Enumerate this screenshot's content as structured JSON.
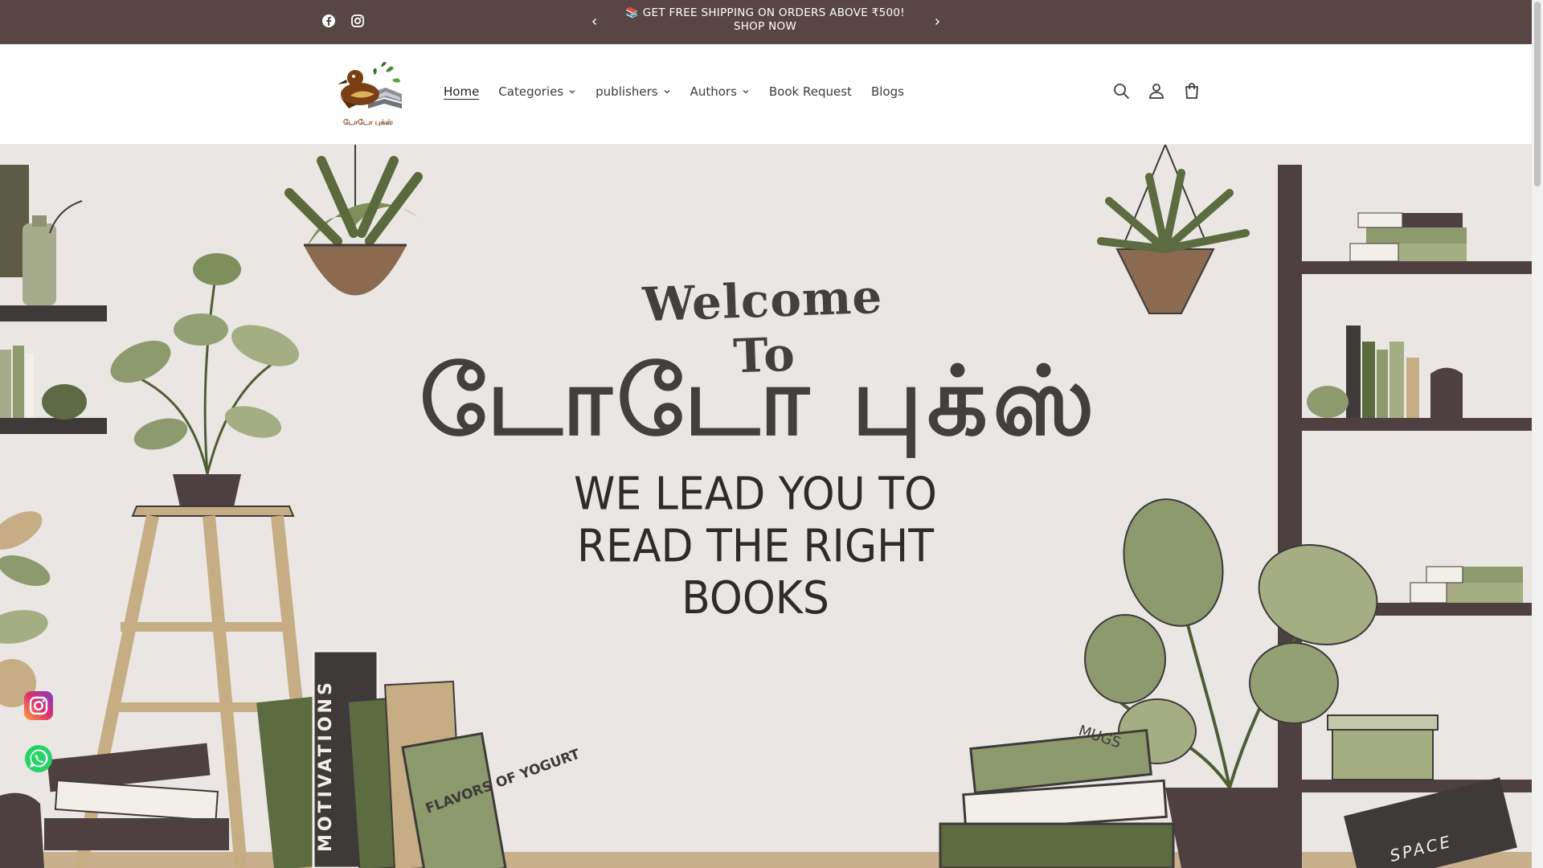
{
  "announcement": {
    "text": "📚 GET FREE SHIPPING ON ORDERS ABOVE ₹500! SHOP NOW",
    "prev_icon": "chevron-left-icon",
    "next_icon": "chevron-right-icon",
    "social": [
      "facebook-icon",
      "instagram-icon"
    ]
  },
  "header": {
    "logo_text": "டோடோ புக்ஸ்",
    "nav": [
      {
        "label": "Home",
        "active": true,
        "dropdown": false
      },
      {
        "label": "Categories",
        "active": false,
        "dropdown": true
      },
      {
        "label": "publishers",
        "active": false,
        "dropdown": true
      },
      {
        "label": "Authors",
        "active": false,
        "dropdown": true
      },
      {
        "label": "Book Request",
        "active": false,
        "dropdown": false
      },
      {
        "label": "Blogs",
        "active": false,
        "dropdown": false
      }
    ],
    "icons": [
      "search-icon",
      "account-icon",
      "cart-icon"
    ]
  },
  "hero": {
    "welcome": "Welcome To",
    "brand": "டோடோ புக்ஸ்",
    "tagline_lines": [
      "WE LEAD YOU TO",
      "READ THE RIGHT",
      "BOOKS"
    ],
    "book_labels": [
      "MOTIVATIONS",
      "FLAVORS OF YOGURT",
      "MUGS",
      "SPACE"
    ]
  },
  "floating": [
    "instagram-float-icon",
    "whatsapp-float-icon"
  ],
  "colors": {
    "announce_bg": "#574643",
    "hero_bg": "#e9e6e3",
    "text_dark": "#433f3f",
    "olive": "#8d9a6e",
    "dark_green": "#5d6b40",
    "brown": "#4e4040"
  }
}
